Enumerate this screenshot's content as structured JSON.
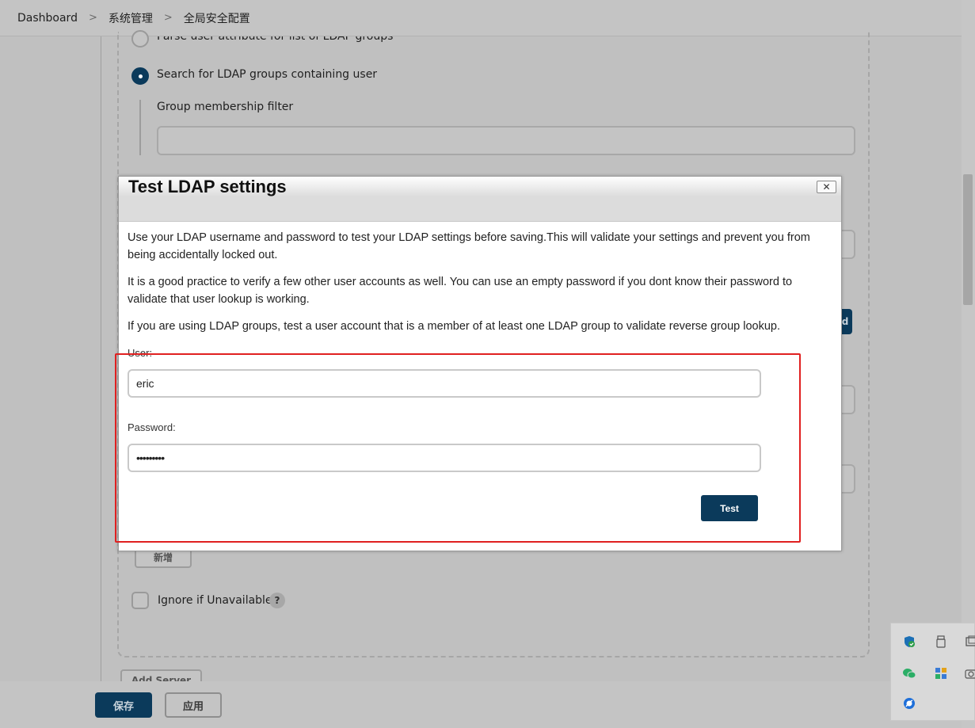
{
  "breadcrumb": {
    "items": [
      "Dashboard",
      "系统管理",
      "全局安全配置"
    ],
    "separator": ">"
  },
  "background": {
    "radio_parse_label": "Parse user attribute for list of LDAP groups",
    "radio_search_label": "Search for LDAP groups containing user",
    "group_filter_label": "Group membership filter",
    "group_filter_value": "",
    "dark_button_fragment": "d",
    "add_button_label": "新增",
    "ignore_label": "Ignore if Unavailable",
    "help_glyph": "?",
    "add_server_label": "Add Server"
  },
  "footer": {
    "save_label": "保存",
    "apply_label": "应用"
  },
  "modal": {
    "title": "Test LDAP settings",
    "close_glyph": "✕",
    "para1": "Use your LDAP username and password to test your LDAP settings before saving.This will validate your settings and prevent you from being accidentally locked out.",
    "para2": "It is a good practice to verify a few other user accounts as well. You can use an empty password if you dont know their password to validate that user lookup is working.",
    "para3": "If you are using LDAP groups, test a user account that is a member of at least one LDAP group to validate reverse group lookup.",
    "user_label": "User:",
    "user_value": "eric",
    "password_label": "Password:",
    "password_value": "•••••••••",
    "test_label": "Test"
  },
  "colors": {
    "primary": "#0b3a5b",
    "highlight": "#e02020",
    "overlay": "#c0c0c0"
  },
  "tray": {
    "icons": [
      "shield-check-icon",
      "usb-drive-icon",
      "window-icon",
      "wechat-icon",
      "app-grid-icon",
      "camera-icon",
      "browser-icon"
    ]
  }
}
